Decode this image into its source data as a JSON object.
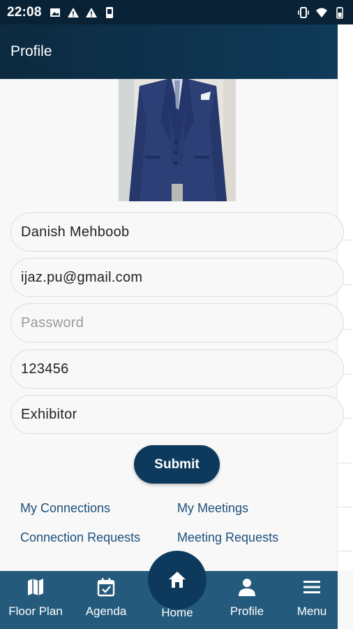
{
  "status_bar": {
    "time": "22:08",
    "left_icons": [
      "image-icon",
      "warning-icon",
      "warning-icon",
      "sim-icon"
    ],
    "right_icons": [
      "vibrate-icon",
      "wifi-icon",
      "battery-icon"
    ]
  },
  "app_bar": {
    "title": "Profile"
  },
  "form": {
    "name": "Danish Mehboob",
    "email": "ijaz.pu@gmail.com",
    "password_placeholder": "Password",
    "phone": "123456",
    "role": "Exhibitor",
    "submit_label": "Submit"
  },
  "links": {
    "my_connections": "My Connections",
    "my_meetings": "My Meetings",
    "connection_requests": "Connection Requests",
    "meeting_requests": "Meeting Requests"
  },
  "bottom_nav": {
    "floor_plan": "Floor Plan",
    "agenda": "Agenda",
    "home": "Home",
    "profile": "Profile",
    "menu": "Menu"
  },
  "colors": {
    "status_bar": "#0a2235",
    "app_bar": "#0f3a59",
    "primary_button": "#0d3a5c",
    "bottom_nav": "#245a7b",
    "link": "#1d4f7c"
  }
}
